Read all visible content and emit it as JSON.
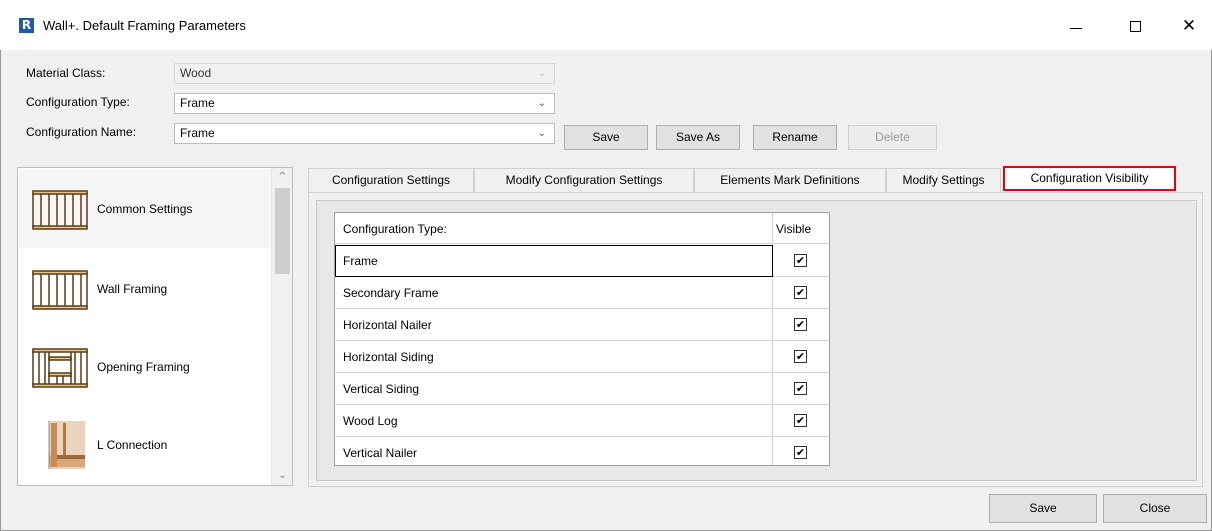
{
  "window": {
    "app_icon": "R",
    "title": "Wall+. Default Framing Parameters",
    "minimize_icon": "minimize-icon",
    "maximize_icon": "maximize-icon",
    "close_icon": "close-icon"
  },
  "form": {
    "material_class_label": "Material Class:",
    "material_class_value": "Wood",
    "configuration_type_label": "Configuration Type:",
    "configuration_type_value": "Frame",
    "configuration_name_label": "Configuration Name:",
    "configuration_name_value": "Frame",
    "buttons": {
      "save": "Save",
      "save_as": "Save As",
      "rename": "Rename",
      "delete": "Delete"
    }
  },
  "sidebar": {
    "items": [
      {
        "label": "Common Settings",
        "icon": "wall-framing-icon"
      },
      {
        "label": "Wall Framing",
        "icon": "wall-framing-icon"
      },
      {
        "label": "Opening Framing",
        "icon": "opening-framing-icon"
      },
      {
        "label": "L Connection",
        "icon": "l-connection-icon"
      }
    ]
  },
  "tabs": [
    {
      "label": "Configuration Settings"
    },
    {
      "label": "Modify Configuration Settings"
    },
    {
      "label": "Elements Mark Definitions"
    },
    {
      "label": "Modify Settings"
    },
    {
      "label": "Configuration Visibility",
      "active": true
    }
  ],
  "grid": {
    "headers": [
      "Configuration Type:",
      "Visible"
    ],
    "rows": [
      {
        "name": "Frame",
        "visible": true
      },
      {
        "name": "Secondary Frame",
        "visible": true
      },
      {
        "name": "Horizontal Nailer",
        "visible": true
      },
      {
        "name": "Horizontal Siding",
        "visible": true
      },
      {
        "name": "Vertical Siding",
        "visible": true
      },
      {
        "name": "Wood Log",
        "visible": true
      },
      {
        "name": "Vertical Nailer",
        "visible": true
      }
    ],
    "check_glyph": "✔"
  },
  "footer": {
    "save": "Save",
    "close": "Close"
  },
  "colors": {
    "highlight_tab_border": "#e8000b",
    "app_icon_bg": "#1e5aa8"
  }
}
